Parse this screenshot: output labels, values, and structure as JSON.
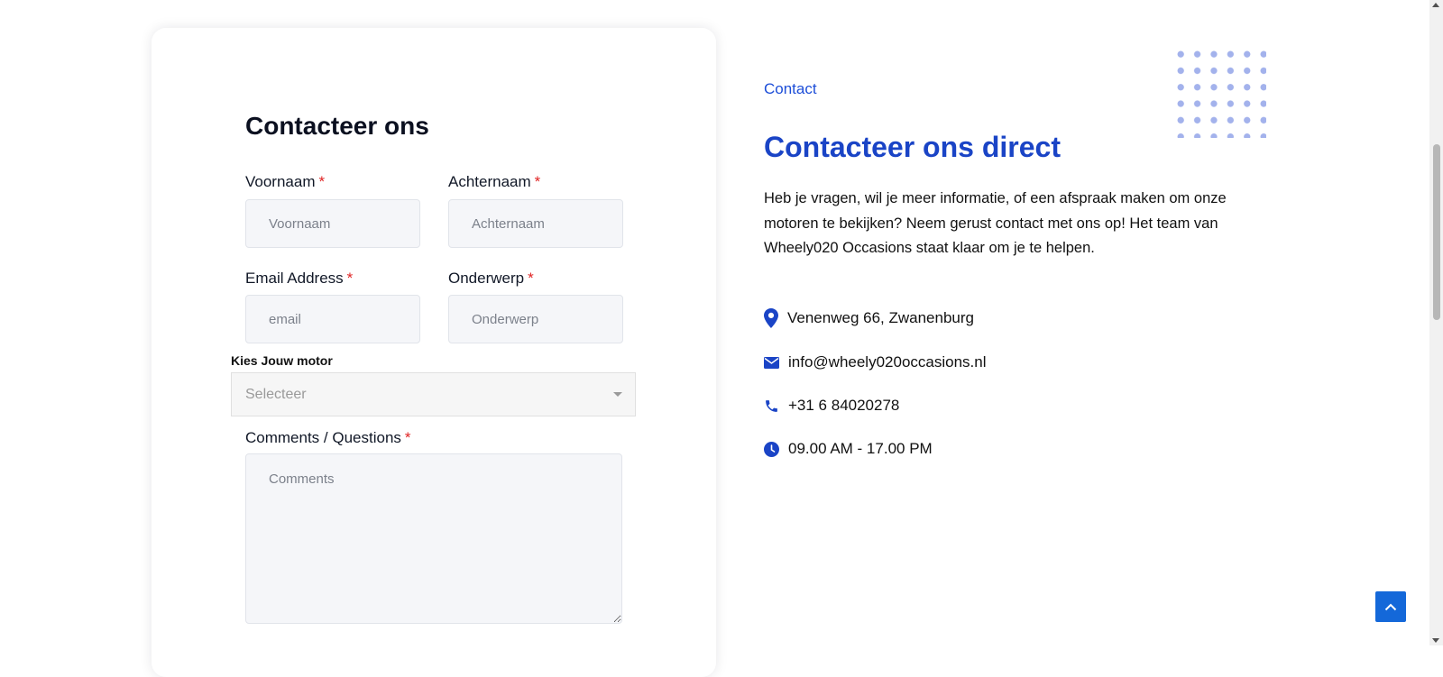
{
  "form": {
    "title": "Contacteer ons",
    "required_marker": "*",
    "first_name": {
      "label": "Voornaam",
      "placeholder": "Voornaam"
    },
    "last_name": {
      "label": "Achternaam",
      "placeholder": "Achternaam"
    },
    "email": {
      "label": "Email Address",
      "placeholder": "email"
    },
    "subject": {
      "label": "Onderwerp",
      "placeholder": "Onderwerp"
    },
    "motor_select": {
      "label": "Kies Jouw motor",
      "selected": "Selecteer"
    },
    "comments": {
      "label": "Comments / Questions",
      "placeholder": "Comments"
    }
  },
  "info": {
    "eyebrow": "Contact",
    "heading": "Contacteer ons direct",
    "intro": "Heb je vragen, wil je meer informatie, of een afspraak maken om onze motoren te bekijken? Neem gerust contact met ons op! Het team van Wheely020 Occasions staat klaar om je te helpen.",
    "address": "Venenweg 66, Zwanenburg",
    "email": "info@wheely020occasions.nl",
    "phone": "+31 6 84020278",
    "hours": "09.00 AM - 17.00 PM"
  },
  "icons": {
    "address": "map-marker-icon",
    "email": "envelope-icon",
    "phone": "phone-icon",
    "hours": "clock-icon",
    "to_top": "chevron-up-icon"
  },
  "colors": {
    "accent": "#1a44c6",
    "eyebrow": "#1d4ed8",
    "required": "#e02424",
    "input_bg": "#f5f6f9",
    "to_top_button": "#1468d9",
    "dots": "#a3b2ec"
  }
}
